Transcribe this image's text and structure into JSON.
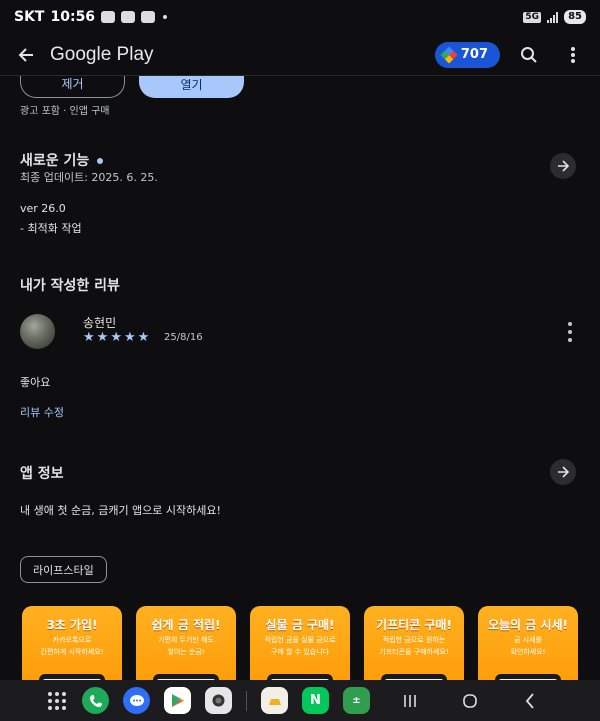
{
  "status_bar": {
    "carrier": "SKT",
    "time": "10:56",
    "network": "5G",
    "battery": "85"
  },
  "app_bar": {
    "title": "Google Play",
    "points": "707"
  },
  "install": {
    "remove_label": "제거",
    "open_label": "열기",
    "ad_note": "광고 포함 · 인앱 구매"
  },
  "whats_new": {
    "title": "새로운 기능",
    "updated": "최종 업데이트: 2025. 6. 25.",
    "version": "ver 26.0",
    "note": "- 최적화 작업"
  },
  "my_review": {
    "title": "내가 작성한 리뷰",
    "reviewer": "송현민",
    "rating": 5,
    "date": "25/8/16",
    "text": "좋아요",
    "edit_label": "리뷰 수정"
  },
  "app_info": {
    "title": "앱 정보",
    "description": "내 생애 첫 순금, 금캐기 앱으로 시작하세요!",
    "category_chip": "라이프스타일"
  },
  "screenshots": [
    {
      "headline": "3초 가입!",
      "sub1": "카카오톡으로",
      "sub2": "간편하게 시작하세요!"
    },
    {
      "headline": "쉽게 금 적립!",
      "sub1": "기편히 두기만 해도",
      "sub2": "쌓이는 순금!"
    },
    {
      "headline": "실물 금 구매!",
      "sub1": "적립한 금을 실물 금으로",
      "sub2": "구매 할 수 있습니다"
    },
    {
      "headline": "기프티콘 구매!",
      "sub1": "적립한 금으로 원하는",
      "sub2": "기프티콘을 구매하세요!"
    },
    {
      "headline": "오늘의 금 시세!",
      "sub1": "금 시세를",
      "sub2": "확인하세요!"
    }
  ],
  "nav_bar": {
    "apps": [
      "phone",
      "messages",
      "play-store",
      "camera",
      "gold-app",
      "naver",
      "calculator"
    ]
  },
  "colors": {
    "background": "#0e0e10",
    "accent": "#a8c7fa",
    "points_pill": "#1a55d6",
    "screenshot_orange": "#ffa010"
  }
}
